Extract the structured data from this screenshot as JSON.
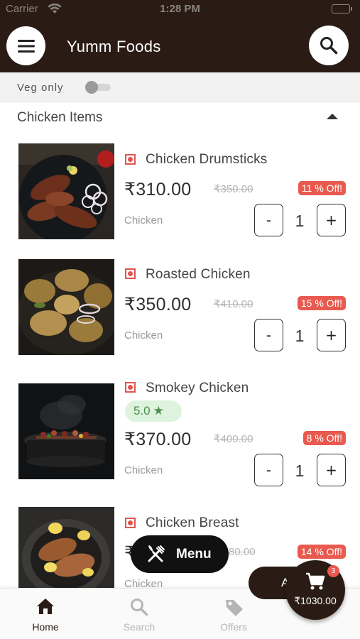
{
  "status_bar": {
    "carrier": "Carrier",
    "time": "1:28 PM"
  },
  "header": {
    "title": "Yumm Foods",
    "menu_icon": "hamburger-menu-icon",
    "search_icon": "search-icon"
  },
  "filter": {
    "veg_only_label": "Veg only",
    "veg_only_on": false
  },
  "section": {
    "title": "Chicken Items",
    "expanded": true
  },
  "items": [
    {
      "name": "Chicken Drumsticks",
      "price": "₹310.00",
      "mrp": "₹350.00",
      "discount": "11 % Off!",
      "category": "Chicken",
      "quantity": "1",
      "minus": "-",
      "plus": "+"
    },
    {
      "name": "Roasted Chicken",
      "price": "₹350.00",
      "mrp": "₹410.00",
      "discount": "15 % Off!",
      "category": "Chicken",
      "quantity": "1",
      "minus": "-",
      "plus": "+"
    },
    {
      "name": "Smokey Chicken",
      "rating": "5.0",
      "price": "₹370.00",
      "mrp": "₹400.00",
      "discount": "8 % Off!",
      "category": "Chicken",
      "quantity": "1",
      "minus": "-",
      "plus": "+"
    },
    {
      "name": "Chicken Breast",
      "price": "₹",
      "mrp": "80.00",
      "discount": "14 % Off!",
      "category": "Chicken"
    }
  ],
  "menu_fab": {
    "label": "Menu",
    "icon": "fork-knife-icon"
  },
  "cart": {
    "pill_text": "A",
    "total": "₹1030.00",
    "badge_count": "3",
    "icon": "cart-icon"
  },
  "tabs": [
    {
      "label": "Home",
      "icon": "home-icon",
      "active": true
    },
    {
      "label": "Search",
      "icon": "search-icon",
      "active": false
    },
    {
      "label": "Offers",
      "icon": "tag-icon",
      "active": false
    }
  ],
  "colors": {
    "header_bg": "#2a1c14",
    "discount_red": "#e85a4f",
    "rating_green": "#4b8f4b"
  }
}
